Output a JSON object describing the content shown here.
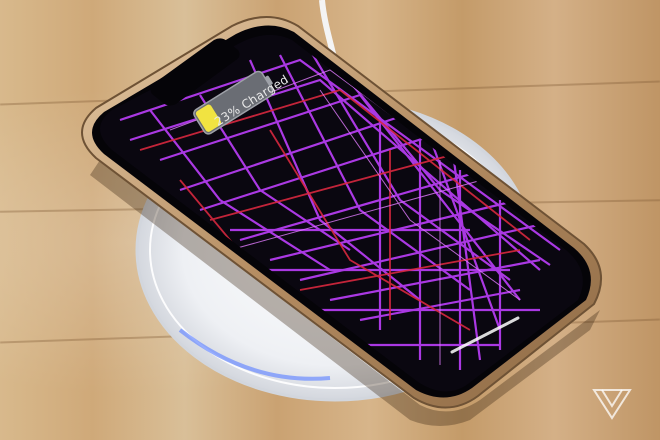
{
  "lock_screen": {
    "charge_status": "23% Charged",
    "charge_percent": 23
  },
  "colors": {
    "wood_light": "#d8b98c",
    "wood_dark": "#c49b69",
    "phone_frame": "#c7a27a",
    "screen_background": "#0a0710",
    "wallpaper_purple": "#b43cf0",
    "wallpaper_red": "#d8283f",
    "battery_fill": "#f1e341",
    "charging_pad": "#f2f2f2"
  },
  "icons": {
    "battery": "battery-icon",
    "watermark": "publication-logo-icon"
  }
}
